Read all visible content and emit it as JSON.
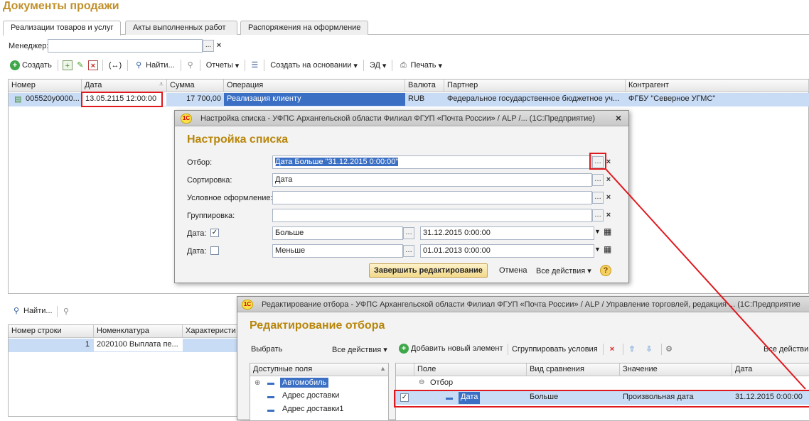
{
  "page_title": "Документы продажи",
  "tabs": [
    "Реализации товаров и услуг",
    "Акты выполненных работ",
    "Распоряжения на оформление"
  ],
  "manager": {
    "label": "Менеджер:",
    "value": "",
    "select_btn": "...",
    "clear_btn": "×"
  },
  "toolbar": {
    "create": "Создать",
    "find": "Найти...",
    "reports": "Отчеты",
    "create_based": "Создать на основании",
    "ed": "ЭД",
    "print": "Печать",
    "link_icon": "(↔)"
  },
  "main_grid": {
    "headers": [
      "Номер",
      "Дата",
      "Сумма",
      "Операция",
      "Валюта",
      "Партнер",
      "Контрагент"
    ],
    "row": {
      "number": "005520у0000...",
      "date": "13.05.2115 12:00:00",
      "sum": "17 700,00",
      "operation": "Реализация клиенту",
      "currency": "RUB",
      "partner": "Федеральное государственное бюджетное уч...",
      "counterparty": "ФГБУ \"Северное УГМС\""
    }
  },
  "dialog1": {
    "title": "Настройка списка - УФПС Архангельской области Филиал ФГУП «Почта России» / ALP /... (1С:Предприятие)",
    "heading": "Настройка списка",
    "close": "×",
    "fields": {
      "filter_label": "Отбор:",
      "filter_value": "Дата Больше \"31.12.2015 0:00:00\"",
      "sort_label": "Сортировка:",
      "sort_value": "Дата",
      "cond_label": "Условное оформление:",
      "cond_value": "",
      "group_label": "Группировка:",
      "group_value": ""
    },
    "date1": {
      "label": "Дата:",
      "checked": true,
      "op": "Больше",
      "value": "31.12.2015  0:00:00"
    },
    "date2": {
      "label": "Дата:",
      "checked": false,
      "op": "Меньше",
      "value": "01.01.2013  0:00:00"
    },
    "finish_btn": "Завершить редактирование",
    "cancel_btn": "Отмена",
    "all_actions": "Все действия",
    "help": "?"
  },
  "lower_toolbar": {
    "find": "Найти..."
  },
  "lower_grid": {
    "headers": [
      "Номер строки",
      "Номенклатура",
      "Характеристи"
    ],
    "row": {
      "num": "1",
      "item": "2020100 Выплата пе...",
      "char": ""
    }
  },
  "dialog2": {
    "title": "Редактирование отбора - УФПС Архангельской области Филиал ФГУП «Почта России» / ALP / Управление торговлей, редакция ... (1С:Предприятие",
    "heading": "Редактирование отбора",
    "toolbar": {
      "select": "Выбрать",
      "all_actions_left": "Все действия",
      "add_new": "Добавить новый элемент",
      "group_conditions": "Сгруппировать условия",
      "all_actions_right": "Все действи"
    },
    "available_fields_header": "Доступные поля",
    "available_fields": [
      "Автомобиль",
      "Адрес доставки",
      "Адрес доставки1"
    ],
    "filter_headers": [
      "Поле",
      "Вид сравнения",
      "Значение",
      "Дата"
    ],
    "filter_root": "Отбор",
    "filter_row": {
      "field": "Дата",
      "comparison": "Больше",
      "value": "Произвольная дата",
      "date": "31.12.2015 0:00:00",
      "checked": true
    }
  },
  "colors": {
    "accent_title": "#c0902a",
    "selection": "#c9dcf5",
    "red_highlight": "#e0191e",
    "dialog_heading": "#b8860b"
  },
  "icons": [
    "create-icon",
    "copy-icon",
    "edit-icon",
    "delete-icon",
    "link-icon",
    "search-icon",
    "clear-search-icon",
    "reports-icon",
    "list-icon",
    "print-icon",
    "help-icon",
    "1c-logo-icon",
    "close-icon",
    "arrow-up-icon",
    "arrow-down-icon",
    "settings-icon"
  ]
}
